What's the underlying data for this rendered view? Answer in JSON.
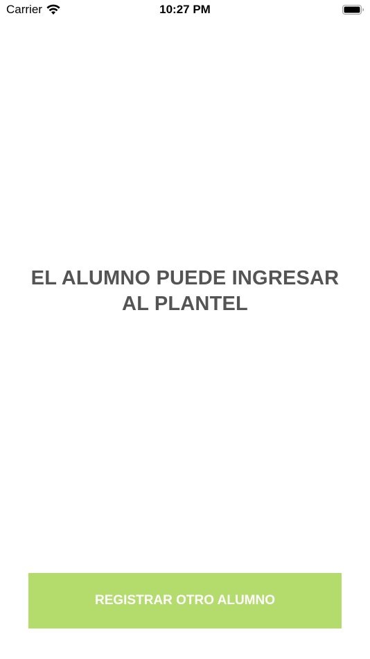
{
  "status_bar": {
    "carrier": "Carrier",
    "time": "10:27 PM",
    "wifi_icon": "wifi-icon",
    "battery_icon": "battery-full-icon"
  },
  "main": {
    "message_line1": "EL ALUMNO PUEDE INGRESAR",
    "message_line2": "AL PLANTEL"
  },
  "footer": {
    "button_label": "REGISTRAR OTRO ALUMNO"
  },
  "colors": {
    "button_background": "#b3dc6c",
    "message_text": "#545454",
    "button_text": "#ffffff",
    "background": "#ffffff"
  }
}
